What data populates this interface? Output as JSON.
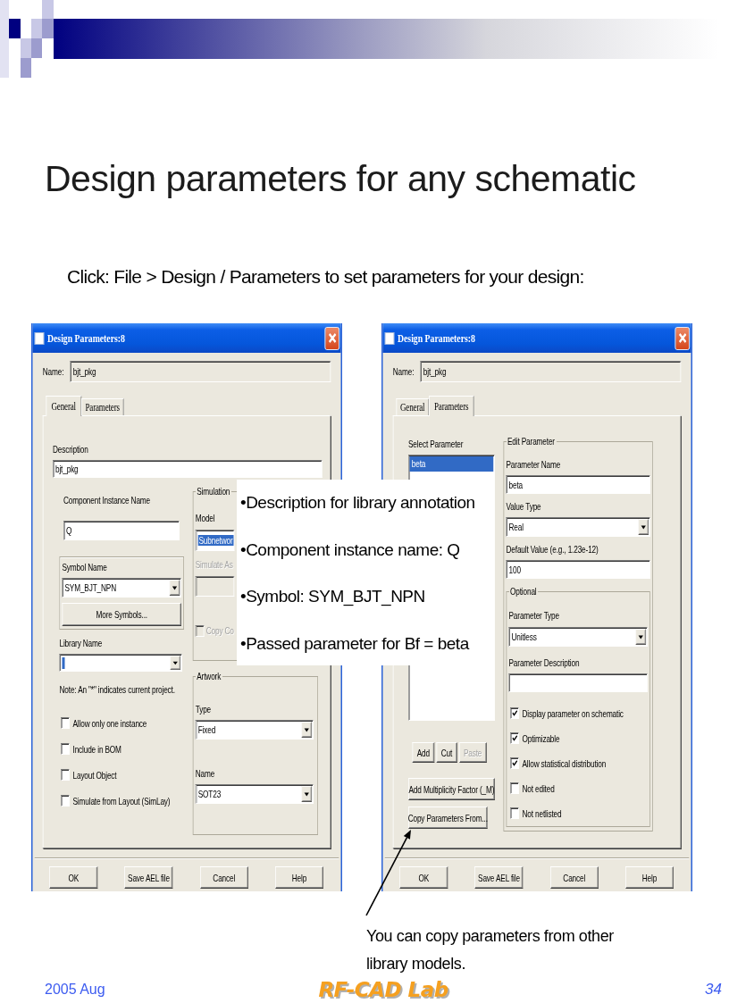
{
  "slide": {
    "title": "Design parameters for any schematic",
    "subtitle": "Click: File > Design / Parameters to set parameters for your design:"
  },
  "dialogs": [
    {
      "title": "Design Parameters:8",
      "name_label": "Name:",
      "name_value": "bjt_pkg",
      "tabs": [
        {
          "label": "General",
          "selected": true
        },
        {
          "label": "Parameters",
          "selected": false
        }
      ],
      "panel": {
        "kind": "general",
        "description": {
          "label": "Description",
          "value": "bjt_pkg"
        },
        "instance_name": {
          "label": "Component Instance Name",
          "value": "Q"
        },
        "symbol": {
          "label": "Symbol Name",
          "value": "SYM_BJT_NPN",
          "button": "More Symbols..."
        },
        "library": {
          "label": "Library Name",
          "highlighted": true
        },
        "note": "Note: An \"*\" indicates current project.",
        "options": [
          {
            "label": "Allow only one instance",
            "checked": false
          },
          {
            "label": "Include in BOM",
            "checked": false
          },
          {
            "label": "Layout Object",
            "checked": false
          },
          {
            "label": "Simulate from Layout (SimLay)",
            "checked": false
          }
        ],
        "simulation": {
          "title": "Simulation",
          "model": {
            "label": "Model",
            "value": "Subnetwor",
            "highlighted": true
          },
          "simulate_as": {
            "label": "Simulate As",
            "disabled": true
          },
          "copy": {
            "label": "Copy Co",
            "checked": false,
            "disabled": true
          }
        },
        "artwork": {
          "title": "Artwork",
          "type": {
            "label": "Type",
            "value": "Fixed"
          },
          "name": {
            "label": "Name",
            "value": "SOT23"
          }
        }
      },
      "buttons": [
        "OK",
        "Save AEL file",
        "Cancel",
        "Help"
      ]
    },
    {
      "title": "Design Parameters:8",
      "name_label": "Name:",
      "name_value": "bjt_pkg",
      "tabs": [
        {
          "label": "General",
          "selected": false
        },
        {
          "label": "Parameters",
          "selected": true
        }
      ],
      "panel": {
        "kind": "parameters",
        "select_label": "Select Parameter",
        "parameters": [
          {
            "label": "beta",
            "selected": true
          }
        ],
        "list_buttons": [
          {
            "label": "Add",
            "disabled": false
          },
          {
            "label": "Cut",
            "disabled": false
          },
          {
            "label": "Paste",
            "disabled": true
          }
        ],
        "multiplicity_button": "Add Multiplicity Factor (_M)",
        "copy_button": "Copy Parameters From...",
        "edit": {
          "title": "Edit Parameter",
          "fields": [
            {
              "kind": "text",
              "label": "Parameter Name",
              "value": "beta"
            },
            {
              "kind": "dropdown",
              "label": "Value Type",
              "value": "Real"
            },
            {
              "kind": "text",
              "label": "Default Value (e.g., 1.23e-12)",
              "value": "100"
            }
          ],
          "optional": {
            "title": "Optional",
            "fields": [
              {
                "kind": "dropdown",
                "label": "Parameter Type",
                "value": "Unitless"
              },
              {
                "kind": "text",
                "label": "Parameter Description"
              }
            ],
            "options": [
              {
                "label": "Display parameter on schematic",
                "checked": true
              },
              {
                "label": "Optimizable",
                "checked": true
              },
              {
                "label": "Allow statistical distribution",
                "checked": true
              },
              {
                "label": "Not edited",
                "checked": false
              },
              {
                "label": "Not netlisted",
                "checked": false
              }
            ]
          }
        }
      },
      "buttons": [
        "OK",
        "Save AEL file",
        "Cancel",
        "Help"
      ]
    }
  ],
  "callout": {
    "bullets": [
      "•Description for library annotation",
      "•Component instance name: Q",
      "•Symbol: SYM_BJT_NPN",
      "•Passed parameter for Bf = beta"
    ]
  },
  "annotation": "You can copy parameters from other library models.",
  "footer": {
    "date": "2005 Aug",
    "logo": "RF-CAD Lab",
    "page": "34"
  }
}
